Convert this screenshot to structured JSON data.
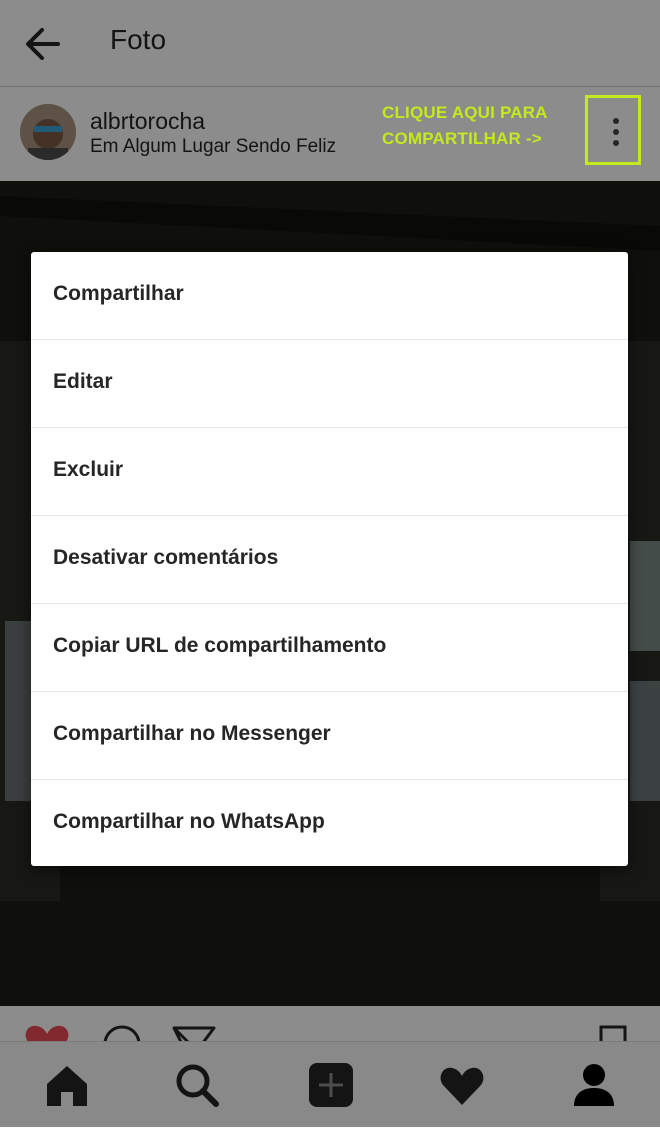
{
  "header": {
    "title": "Foto"
  },
  "post": {
    "username": "albrtorocha",
    "location": "Em Algum Lugar Sendo Feliz",
    "annotation_line1": "CLIQUE AQUI PARA",
    "annotation_line2": "COMPARTILHAR ->"
  },
  "menu": {
    "items": [
      {
        "label": "Compartilhar"
      },
      {
        "label": "Editar"
      },
      {
        "label": "Excluir"
      },
      {
        "label": "Desativar comentários"
      },
      {
        "label": "Copiar URL de compartilhamento"
      },
      {
        "label": "Compartilhar no Messenger"
      },
      {
        "label": "Compartilhar no WhatsApp"
      }
    ]
  },
  "icons": {
    "back": "back-arrow-icon",
    "more": "more-vertical-icon",
    "like": "heart-filled-icon",
    "comment": "comment-icon",
    "share": "send-icon",
    "save": "bookmark-icon",
    "tabs": [
      "home-icon",
      "search-icon",
      "add-icon",
      "activity-heart-icon",
      "profile-icon"
    ]
  },
  "colors": {
    "annotation": "#c3ea1c",
    "like": "#ed4956",
    "text": "#262626"
  }
}
